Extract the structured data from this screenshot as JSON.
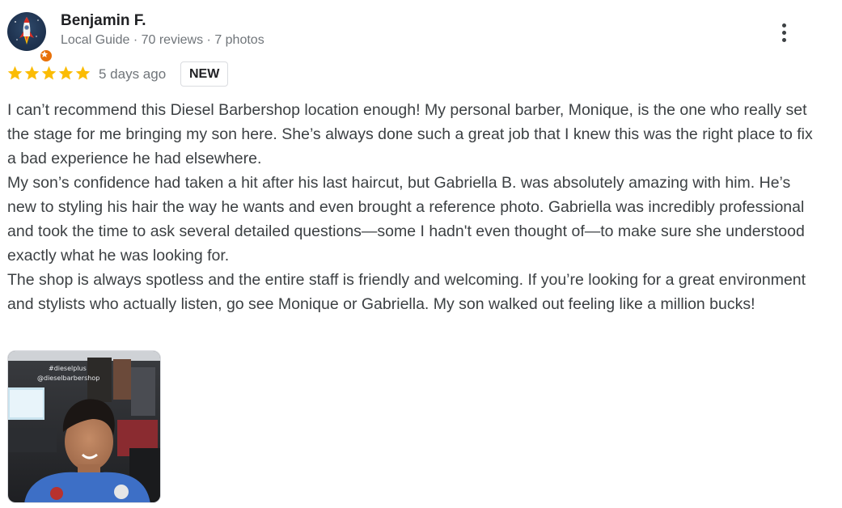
{
  "reviewer": {
    "name": "Benjamin F.",
    "level": "Local Guide",
    "separator": " · ",
    "reviews": "70 reviews",
    "photos": "7 photos",
    "avatar_icon": "rocket-avatar-icon",
    "badge_icon": "local-guide-star-icon"
  },
  "rating": {
    "stars": 5,
    "max": 5,
    "color": "#fbbc04"
  },
  "time_ago": "5 days ago",
  "new_badge": "NEW",
  "review_paragraphs": [
    "I can’t recommend this Diesel Barbershop location enough! My personal barber, Monique, is the one who really set the stage for me bringing my son here. She’s always done such a great job that I knew this was the right place to fix a bad experience he had elsewhere.",
    "My son’s confidence had taken a hit after his last haircut, but Gabriella B. was absolutely amazing with him. He’s new to styling his hair the way he wants and even brought a reference photo. Gabriella was incredibly professional and took the time to ask several detailed questions—some I hadn't even thought of—to make sure she understood exactly what he was looking for.",
    "The shop is always spotless and the entire staff is friendly and welcoming. If you’re looking for a great environment and stylists who actually listen, go see Monique or Gabriella. My son walked out feeling like a million bucks!"
  ],
  "photo": {
    "overlay_line1": "#dieselplus",
    "overlay_line2": "@dieselbarbershop"
  },
  "colors": {
    "guide_badge": "#e8710a",
    "text_secondary": "#70757a"
  }
}
